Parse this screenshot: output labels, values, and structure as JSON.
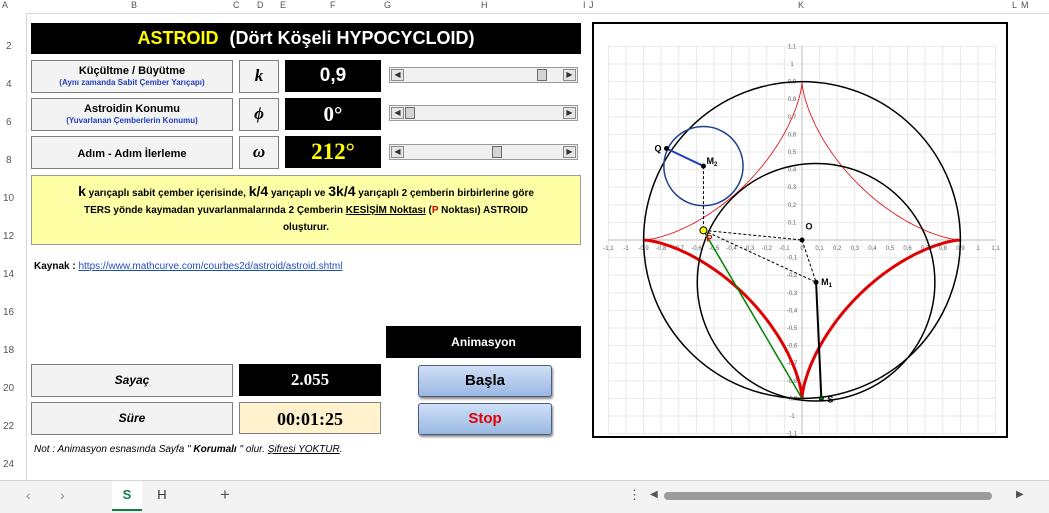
{
  "columns": [
    "A",
    "B",
    "C",
    "D",
    "E",
    "F",
    "G",
    "H",
    "I",
    "J",
    "K",
    "L",
    "M"
  ],
  "rows": [
    "2",
    "4",
    "6",
    "8",
    "10",
    "12",
    "14",
    "16",
    "18",
    "20",
    "22",
    "24"
  ],
  "title": {
    "main": "ASTROID",
    "sub": "(Dört Köşeli HYPOCYCLOID)"
  },
  "controls": [
    {
      "label": "Küçültme / Büyütme",
      "sublabel": "(Aynı zamanda Sabit Çember Yarıçapı)",
      "symbol": "k",
      "value": "0,9",
      "thumb_fraction": 0.9
    },
    {
      "label": "Astroidin Konumu",
      "sublabel": "(Yuvarlanan Çemberlerin Konumu)",
      "symbol": "ϕ",
      "value": "0°",
      "thumb_fraction": 0.0
    },
    {
      "label": "Adım - Adım İlerleme",
      "sublabel": "",
      "symbol": "ω",
      "value": "212°",
      "thumb_fraction": 0.59
    }
  ],
  "info": {
    "k1": "k",
    "t1": " yarıçaplı sabit çember içerisinde, ",
    "k2": "k/4",
    "t2": " yarıçaplı  ve  ",
    "k3": "3k/4",
    "t3": " yarıçaplı  2 çemberin birbirlerine göre",
    "t4": "TERS yönde kaymadan yuvarlanmalarında 2 Çemberin ",
    "t5": "KESİŞİM Noktası",
    "t6": " (",
    "t7": "P",
    "t8": " Noktası)  ASTROID",
    "t9": "oluşturur."
  },
  "source": {
    "label": "Kaynak : ",
    "url": "https://www.mathcurve.com/courbes2d/astroid/astroid.shtml"
  },
  "animation": {
    "header": "Animasyon",
    "start": "Başla",
    "stop": "Stop"
  },
  "counter": {
    "label": "Sayaç",
    "value": "2.055"
  },
  "time": {
    "label": "Süre",
    "value": "00:01:25"
  },
  "note": {
    "prefix": "Not : Animasyon esnasında Sayfa \" ",
    "bold": "Korumalı",
    "mid": " \" olur.  ",
    "underline": "Şifresi YOKTUR",
    "suffix": "."
  },
  "sheets": [
    "S",
    "H"
  ],
  "active_sheet": "S",
  "chart": {
    "xticks": [
      "-1,1",
      "-1",
      "-0,9",
      "-0,8",
      "-0,7",
      "-0,6",
      "-0,5",
      "-0,4",
      "-0,3",
      "-0,2",
      "-0,1",
      "0",
      "0,1",
      "0,2",
      "0,3",
      "0,4",
      "0,5",
      "0,6",
      "0,7",
      "0,8",
      "0,9",
      "1",
      "1,1"
    ],
    "yticks": [
      "1,1",
      "1",
      "0,9",
      "0,8",
      "0,7",
      "0,6",
      "0,5",
      "0,4",
      "0,3",
      "0,2",
      "0,1",
      "0",
      "-0,1",
      "-0,2",
      "-0,3",
      "-0,4",
      "-0,5",
      "-0,6",
      "-0,7",
      "-0,8",
      "-0,9",
      "-1",
      "-1,1"
    ],
    "points": {
      "O": "O",
      "M1": "M",
      "M2": "M",
      "Q": "Q",
      "P": "P",
      "S": "S"
    },
    "k": 0.9
  },
  "colors": {
    "accent_yellow": "#ffff00",
    "info_bg": "#ffffa6",
    "time_bg": "#fff2cc",
    "red": "#e00000",
    "green": "#008000",
    "blue": "#1f3f8f"
  }
}
